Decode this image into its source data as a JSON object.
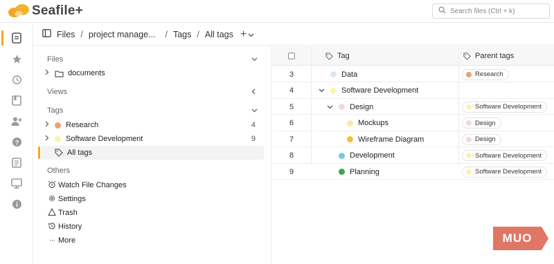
{
  "header": {
    "logo_text": "Seafile+",
    "search_placeholder": "Search files (Ctrl + k)"
  },
  "breadcrumb": {
    "items": [
      "Files",
      "project manage...",
      "Tags",
      "All tags"
    ],
    "separator": "/",
    "add_icon": "plus-icon"
  },
  "sidebar": {
    "files_title": "Files",
    "files_items": [
      {
        "label": "documents",
        "icon": "folder-icon"
      }
    ],
    "views_title": "Views",
    "tags_title": "Tags",
    "tags_items": [
      {
        "label": "Research",
        "count": "4",
        "color": "#e8a173"
      },
      {
        "label": "Software Development",
        "count": "9",
        "color": "#fbf2b3"
      }
    ],
    "all_tags_label": "All tags",
    "others_title": "Others",
    "others_items": [
      {
        "label": "Watch File Changes",
        "icon": "alarm-icon"
      },
      {
        "label": "Settings",
        "icon": "gear-icon"
      },
      {
        "label": "Trash",
        "icon": "trash-icon"
      },
      {
        "label": "History",
        "icon": "history-icon"
      },
      {
        "label": "More",
        "icon": "more-icon"
      }
    ]
  },
  "table": {
    "columns": {
      "tag": "Tag",
      "parent": "Parent tags"
    },
    "rows": [
      {
        "index": "3",
        "name": "Data",
        "color": "#dbe6f5",
        "parent": "Research",
        "parent_color": "#e8a173",
        "level": 0,
        "expand": ""
      },
      {
        "index": "4",
        "name": "Software Development",
        "color": "#fbf2b3",
        "parent": "",
        "parent_color": "",
        "level": 0,
        "expand": "⌄"
      },
      {
        "index": "5",
        "name": "Design",
        "color": "#f6d8dc",
        "parent": "Software Development",
        "parent_color": "#fbf2b3",
        "level": 1,
        "expand": "⌄"
      },
      {
        "index": "6",
        "name": "Mockups",
        "color": "#f8e9a8",
        "parent": "Design",
        "parent_color": "#f6d8dc",
        "level": 2,
        "expand": ""
      },
      {
        "index": "7",
        "name": "Wireframe Diagram",
        "color": "#f2c232",
        "parent": "Design",
        "parent_color": "#f6d8dc",
        "level": 2,
        "expand": ""
      },
      {
        "index": "8",
        "name": "Development",
        "color": "#7cc7d6",
        "parent": "Software Development",
        "parent_color": "#fbf2b3",
        "level": 1,
        "expand": ""
      },
      {
        "index": "9",
        "name": "Planning",
        "color": "#3aa856",
        "parent": "Software Development",
        "parent_color": "#fbf2b3",
        "level": 1,
        "expand": ""
      }
    ]
  },
  "watermark": {
    "text": "MUO"
  },
  "colors": {
    "accent": "#f5a623",
    "badge": "#e07766"
  }
}
